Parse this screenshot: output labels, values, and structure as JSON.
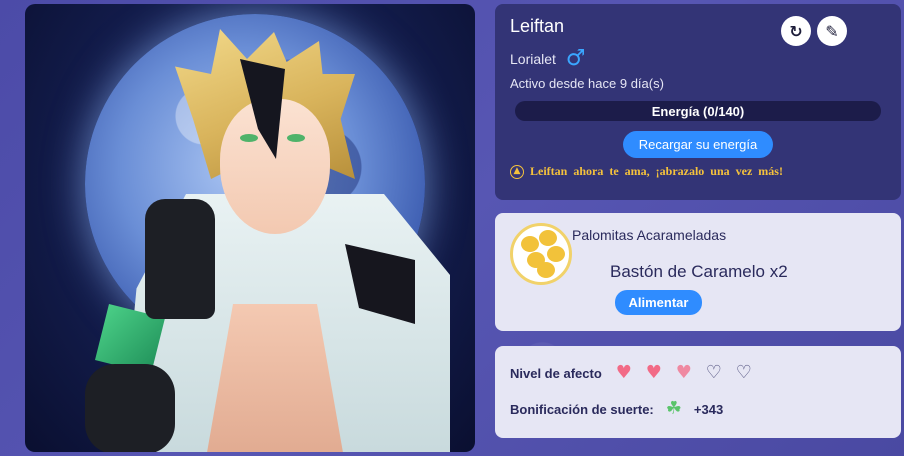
{
  "character": {
    "name": "Leiftan",
    "owner": "Lorialet",
    "gender_icon": "male-symbol-icon",
    "activity": "Activo desde hace 9 día(s)",
    "energy_label": "Energía (0/140)",
    "energy_current": 0,
    "energy_max": 140,
    "recharge_label": "Recargar su energía",
    "love_message": "Leiftan ahora te ama, ¡abrazalo una vez más!"
  },
  "food": {
    "name": "Palomitas Acarameladas",
    "item_text": "Bastón de Caramelo x2",
    "feed_label": "Alimentar"
  },
  "stats": {
    "affection_label": "Nivel de afecto",
    "affection_hearts": [
      "full",
      "full",
      "half",
      "empty",
      "empty"
    ],
    "luck_label": "Bonificación de suerte:",
    "luck_value": "+343"
  },
  "colors": {
    "accent": "#2f8cff",
    "panel_dark": "#333476",
    "panel_light": "#e6e6f4",
    "love_text": "#f5c23c",
    "heart": "#f26a86"
  }
}
